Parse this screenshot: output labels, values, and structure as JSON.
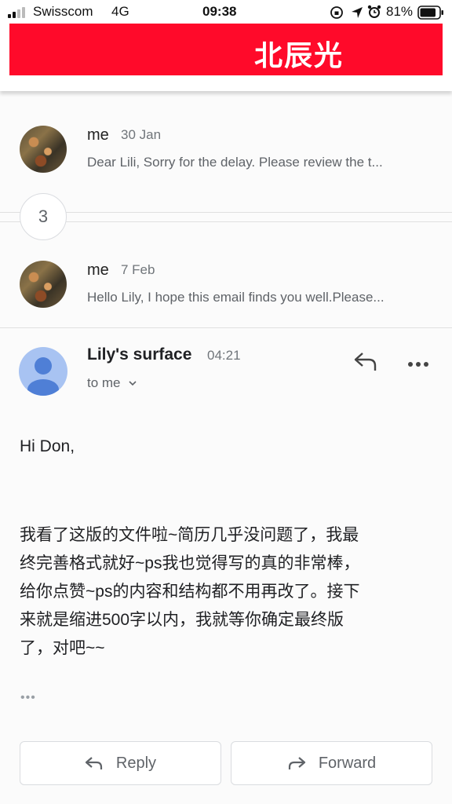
{
  "status_bar": {
    "carrier": "Swisscom",
    "network": "4G",
    "time": "09:38",
    "battery": "81%"
  },
  "header": {
    "banner_text": "北辰光",
    "banner_color": "#ff0a2a"
  },
  "thread": {
    "collapsed_count": "3",
    "messages": [
      {
        "sender": "me",
        "date": "30 Jan",
        "snippet": "Dear Lili, Sorry for the delay. Please review the t..."
      },
      {
        "sender": "me",
        "date": "7 Feb",
        "snippet": "Hello Lily, I hope this email finds you well.Please..."
      }
    ]
  },
  "open_message": {
    "sender": "Lily's surface",
    "time": "04:21",
    "recipient": "to me",
    "greeting": "Hi Don,",
    "body_lines": [
      "我看了这版的文件啦~简历几乎没问题了，我最",
      "终完善格式就好~ps我也觉得写的真的非常棒，",
      "给你点赞~ps的内容和结构都不用再改了。接下",
      "来就是缩进500字以内，我就等你确定最终版",
      "了，对吧~~"
    ],
    "more": "•••"
  },
  "actions": {
    "reply_label": "Reply",
    "forward_label": "Forward"
  },
  "colors": {
    "avatar_user": "#a8c3f2",
    "avatar_user_figure": "#4f7fd6"
  }
}
